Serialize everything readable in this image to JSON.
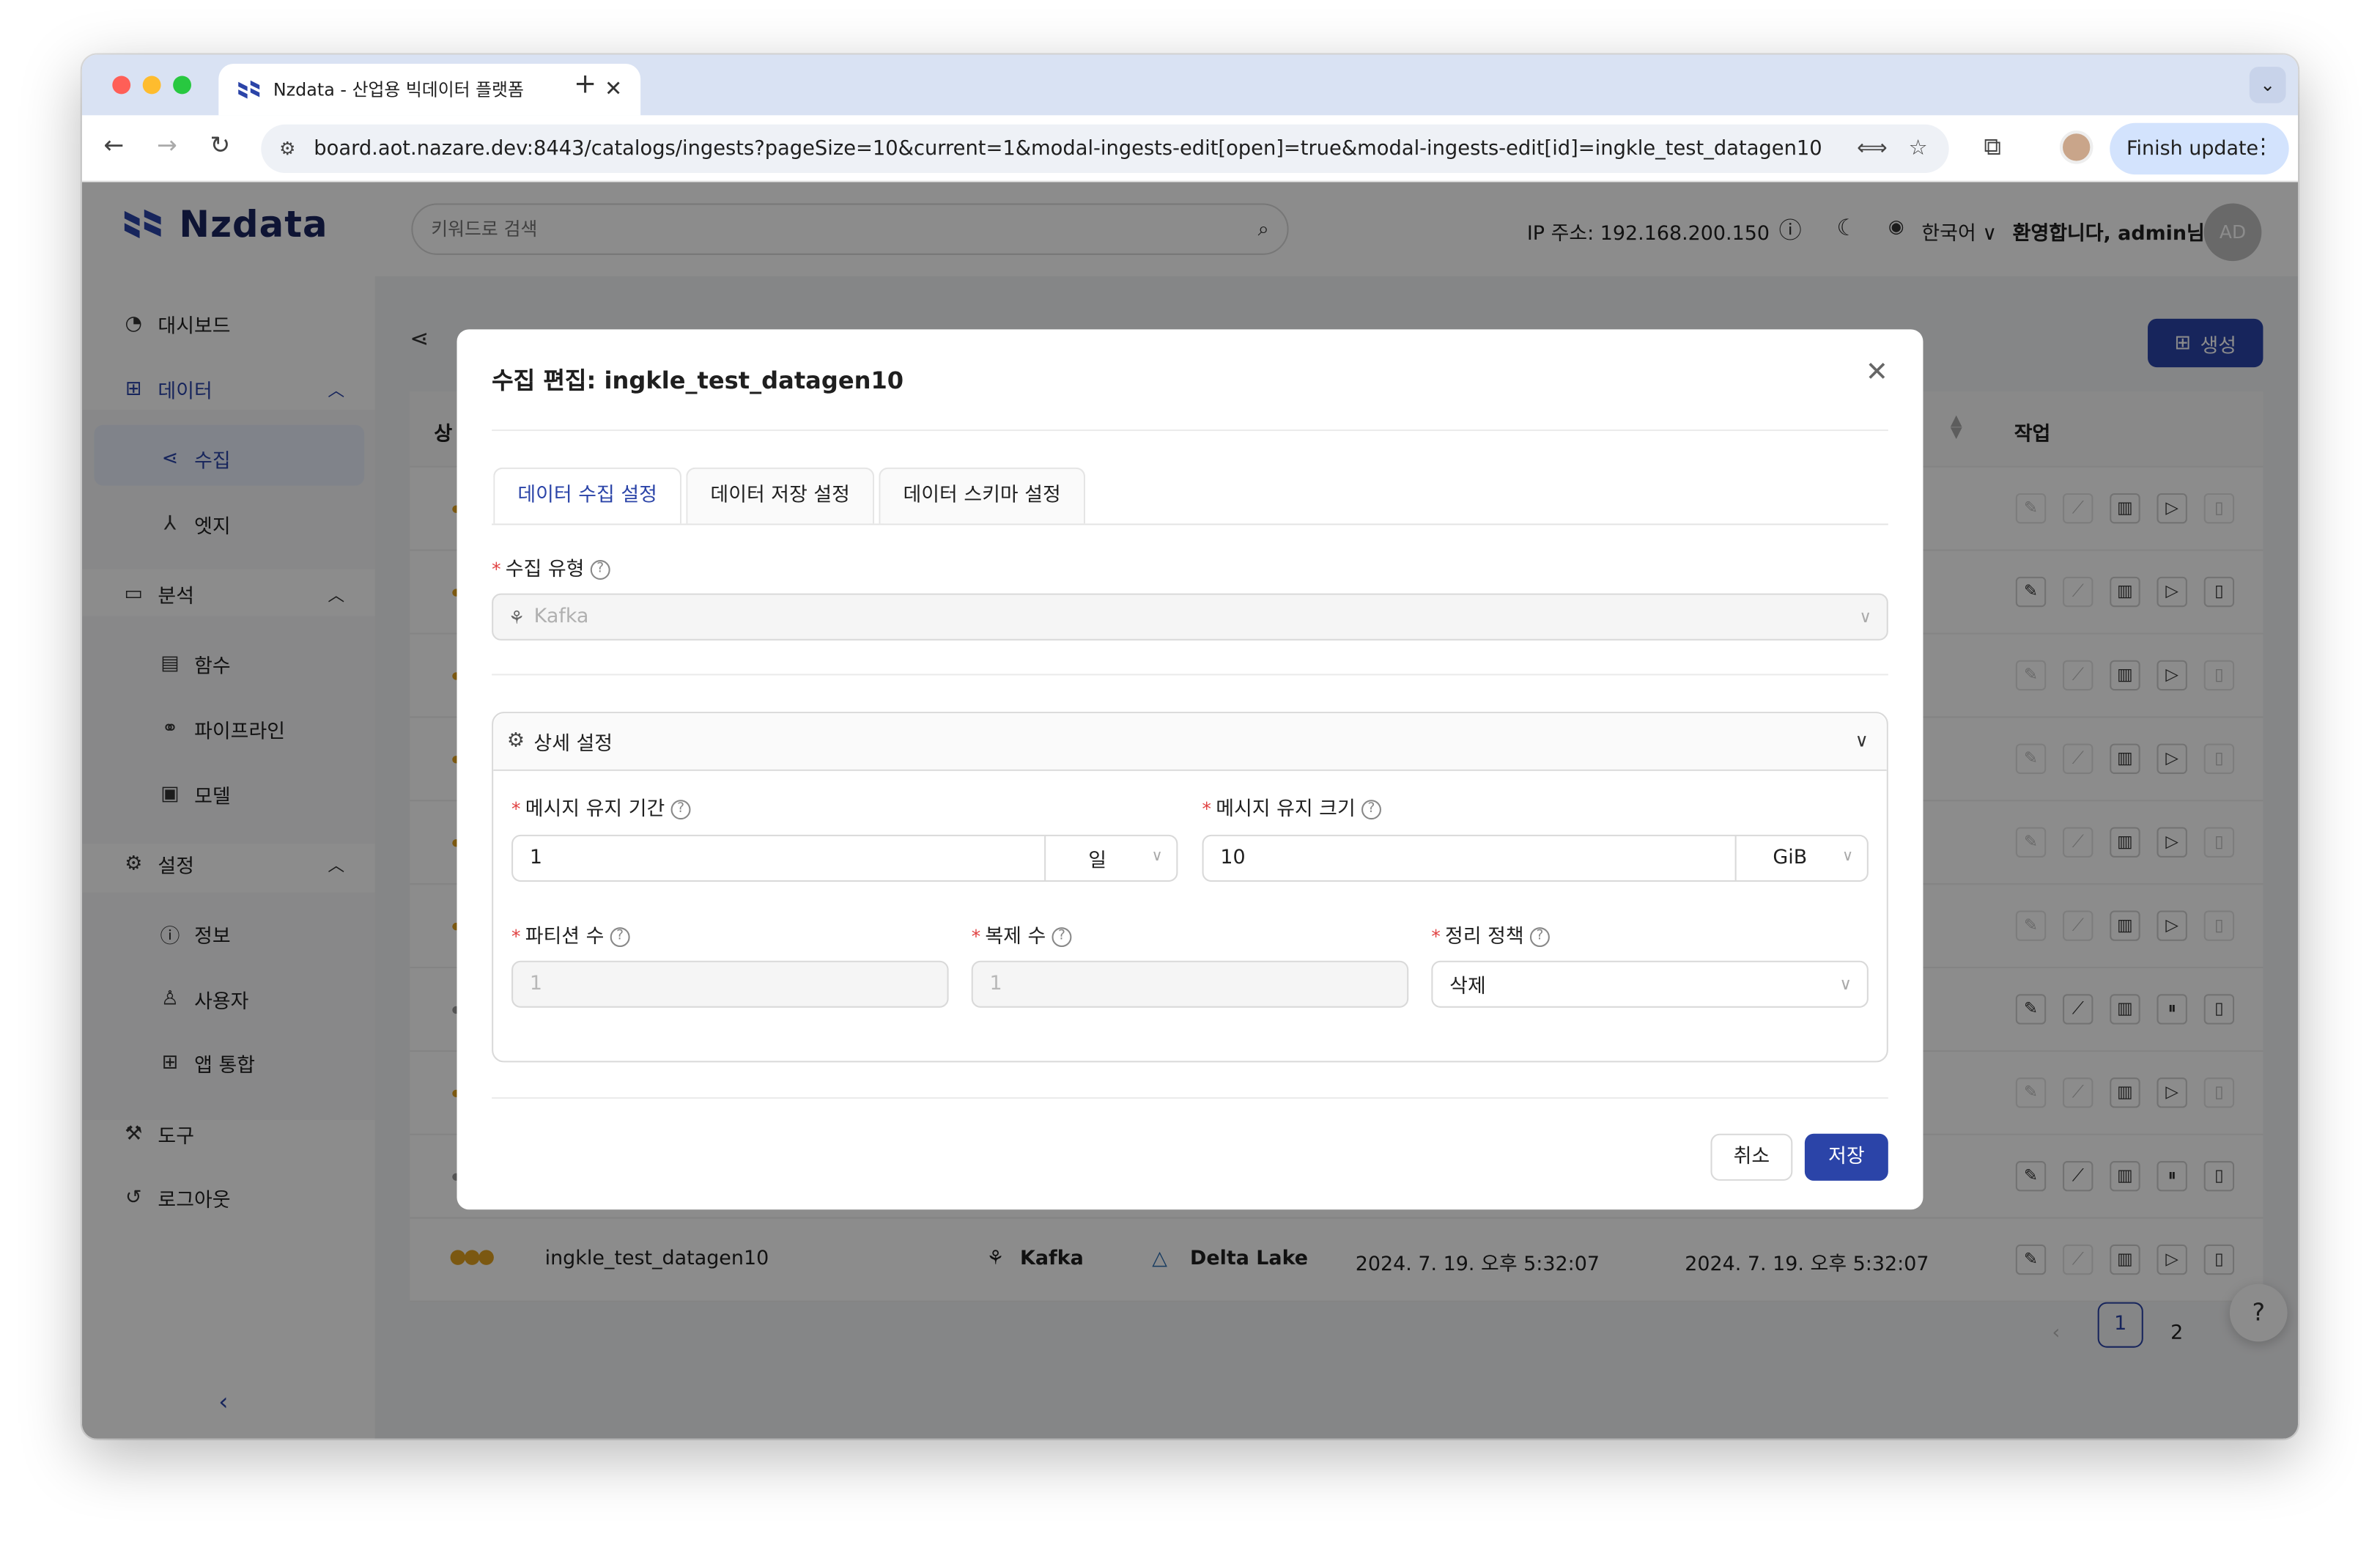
{
  "browser": {
    "tab_title": "Nzdata - 산업용 빅데이터 플랫폼",
    "url": "board.aot.nazare.dev:8443/catalogs/ingests?pageSize=10&current=1&modal-ingests-edit[open]=true&modal-ingests-edit[id]=ingkle_test_datagen10",
    "finish_update": "Finish update"
  },
  "header": {
    "brand": "Nzdata",
    "search_placeholder": "키워드로 검색",
    "ip_label": "IP 주소: 192.168.200.150",
    "language": "한국어",
    "welcome": "환영합니다, admin님",
    "avatar_initials": "AD"
  },
  "sidebar": {
    "items": [
      {
        "label": "대시보드",
        "icon": "dashboard-icon"
      },
      {
        "label": "데이터",
        "icon": "grid-icon"
      },
      {
        "label": "수집",
        "icon": "share-icon"
      },
      {
        "label": "엣지",
        "icon": "edge-icon"
      },
      {
        "label": "분석",
        "icon": "monitor-icon"
      },
      {
        "label": "함수",
        "icon": "file-icon"
      },
      {
        "label": "파이프라인",
        "icon": "pipeline-icon"
      },
      {
        "label": "모델",
        "icon": "model-icon"
      },
      {
        "label": "설정",
        "icon": "gear-icon"
      },
      {
        "label": "정보",
        "icon": "info-icon"
      },
      {
        "label": "사용자",
        "icon": "user-icon"
      },
      {
        "label": "앱 통합",
        "icon": "apps-icon"
      },
      {
        "label": "도구",
        "icon": "tool-icon"
      },
      {
        "label": "로그아웃",
        "icon": "logout-icon"
      }
    ]
  },
  "page": {
    "create_label": "생성",
    "columns": {
      "status": "상",
      "actions": "작업"
    },
    "last_row": {
      "name": "ingkle_test_datagen10",
      "source": "Kafka",
      "sink": "Delta Lake",
      "created": "2024. 7. 19. 오후 5:32:07",
      "updated": "2024. 7. 19. 오후 5:32:07"
    },
    "pagination": {
      "current": "1",
      "next": "2"
    }
  },
  "modal": {
    "title": "수집 편집:",
    "title_id": "ingkle_test_datagen10",
    "tabs": [
      "데이터 수집 설정",
      "데이터 저장 설정",
      "데이터 스키마 설정"
    ],
    "ingest_type_label": "수집 유형",
    "ingest_type_value": "Kafka",
    "advanced_label": "상세 설정",
    "retention_period_label": "메시지 유지 기간",
    "retention_period_value": "1",
    "retention_period_unit": "일",
    "retention_size_label": "메시지 유지 크기",
    "retention_size_value": "10",
    "retention_size_unit": "GiB",
    "partitions_label": "파티션 수",
    "partitions_value": "1",
    "replicas_label": "복제 수",
    "replicas_value": "1",
    "cleanup_label": "정리 정책",
    "cleanup_value": "삭제",
    "cancel_label": "취소",
    "save_label": "저장"
  },
  "colors": {
    "primary": "#2b44a8",
    "status_dot": "#e0a020",
    "required": "#e04040"
  }
}
